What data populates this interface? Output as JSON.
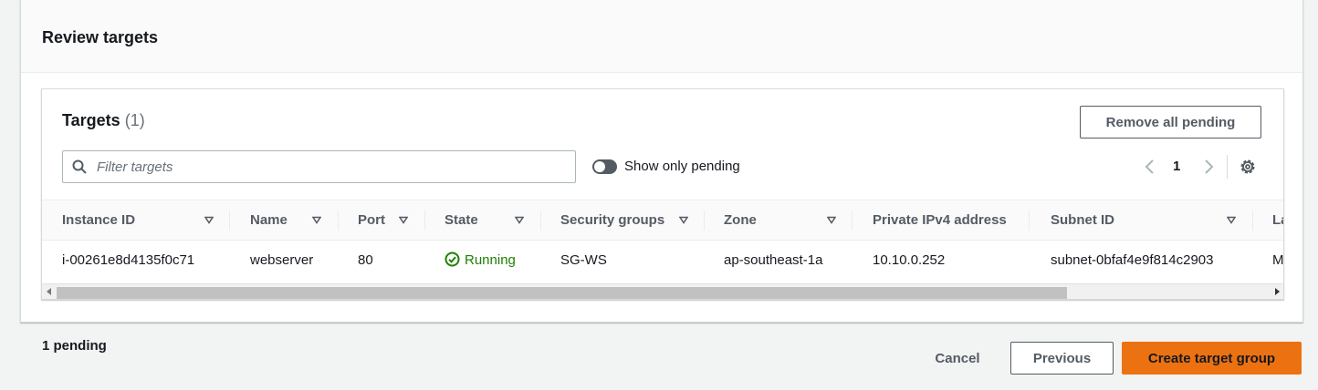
{
  "review": {
    "title": "Review targets"
  },
  "targets": {
    "title": "Targets",
    "count": "(1)",
    "remove_all_label": "Remove all pending",
    "filter_placeholder": "Filter targets",
    "toggle_label": "Show only pending",
    "toggle_on": false,
    "page": "1",
    "columns": [
      "Instance ID",
      "Name",
      "Port",
      "State",
      "Security groups",
      "Zone",
      "Private IPv4 address",
      "Subnet ID",
      "La"
    ],
    "rows": [
      {
        "instance_id": "i-00261e8d4135f0c71",
        "name": "webserver",
        "port": "80",
        "state": "Running",
        "security_groups": "SG-WS",
        "zone": "ap-southeast-1a",
        "private_ipv4": "10.10.0.252",
        "subnet_id": "subnet-0bfaf4e9f814c2903",
        "launch": "M"
      }
    ]
  },
  "footer": {
    "pending": "1 pending",
    "cancel_label": "Cancel",
    "previous_label": "Previous",
    "create_label": "Create target group"
  },
  "colors": {
    "primary": "#ec7211",
    "success": "#1d8102",
    "text": "#16191f",
    "secondary_text": "#545b64"
  },
  "icons": [
    "search-icon",
    "chevron-left-icon",
    "chevron-right-icon",
    "gear-icon",
    "sort-caret-icon",
    "status-ok-icon"
  ]
}
